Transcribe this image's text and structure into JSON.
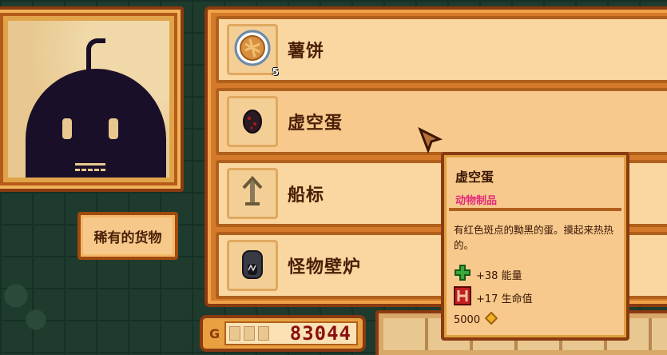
{
  "shop": {
    "items": [
      {
        "name": "薯饼",
        "icon": "hashbrown-icon",
        "qty": "5"
      },
      {
        "name": "虚空蛋",
        "icon": "void-egg-icon"
      },
      {
        "name": "船标",
        "icon": "buoy-marker-icon"
      },
      {
        "name": "怪物壁炉",
        "icon": "monster-fireplace-icon"
      }
    ]
  },
  "rare_tab": {
    "label": "稀有的货物"
  },
  "money": {
    "prefix": "G",
    "value": "83044"
  },
  "tooltip": {
    "title": "虚空蛋",
    "category": "动物制品",
    "description": "有红色斑点的黝黑的蛋。摸起来热热的。",
    "energy": "+38 能量",
    "health": "+17 生命值",
    "price": "5000"
  },
  "colors": {
    "category": "#e4287a",
    "energy": "#3aa83a",
    "health": "#c02020",
    "money": "#8a1010"
  }
}
